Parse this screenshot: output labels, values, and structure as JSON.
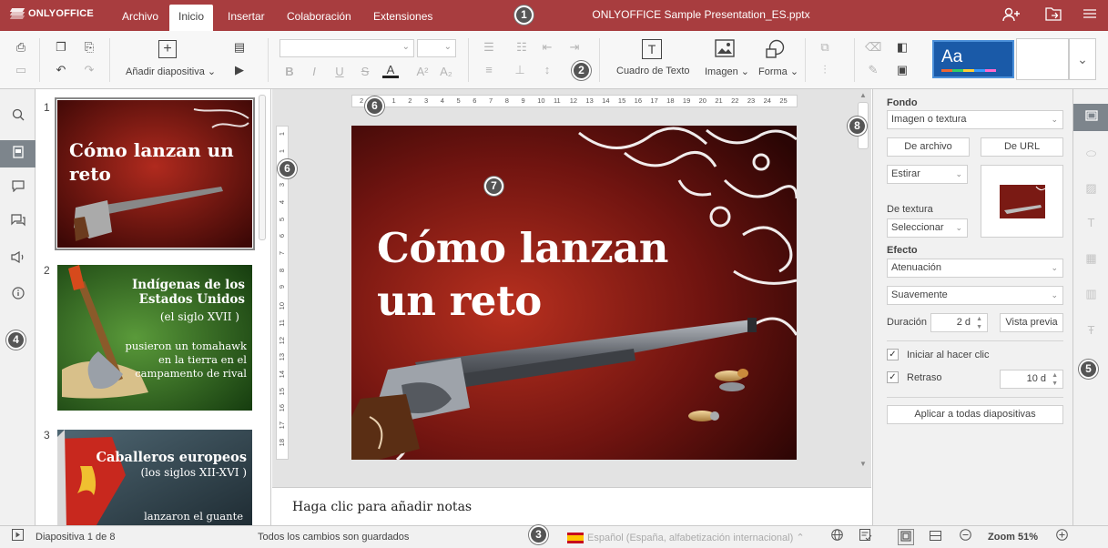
{
  "titlebar": {
    "logo": "ONLYOFFICE",
    "tabs": [
      "Archivo",
      "Inicio",
      "Insertar",
      "Colaboración",
      "Extensiones"
    ],
    "active_tab": "Inicio",
    "doc_title": "ONLYOFFICE Sample Presentation_ES.pptx"
  },
  "toolbar": {
    "add_slide": "Añadir diapositiva",
    "text_box": "Cuadro de Texto",
    "image": "Imagen",
    "shape": "Forma",
    "theme_sample": "Aa"
  },
  "thumbnails": [
    {
      "num": "1",
      "title": "Cómo lanzan un reto"
    },
    {
      "num": "2",
      "title": "Indígenas de los Estados Unidos",
      "subtitle": "(el siglo XVII )",
      "body": "pusieron un tomahawk en la tierra en el campamento de rival"
    },
    {
      "num": "3",
      "title": "Caballeros europeos",
      "subtitle": "(los siglos XII-XVI )",
      "body": "lanzaron el guante"
    }
  ],
  "slide": {
    "title_line1": "Cómo lanzan",
    "title_line2": "un reto"
  },
  "ruler": {
    "h_ticks": [
      "2",
      "1",
      "1",
      "2",
      "3",
      "4",
      "5",
      "6",
      "7",
      "8",
      "9",
      "10",
      "11",
      "12",
      "13",
      "14",
      "15",
      "16",
      "17",
      "18",
      "19",
      "20",
      "21",
      "22",
      "23",
      "24",
      "25"
    ],
    "v_ticks": [
      "1",
      "1",
      "2",
      "3",
      "4",
      "5",
      "6",
      "7",
      "8",
      "9",
      "10",
      "11",
      "12",
      "13",
      "14",
      "15",
      "16",
      "17",
      "18"
    ]
  },
  "notes_placeholder": "Haga clic para añadir notas",
  "right_panel": {
    "fill_label": "Fondo",
    "fill_value": "Imagen o textura",
    "from_file": "De archivo",
    "from_url": "De URL",
    "stretch_value": "Estirar",
    "texture_label": "De textura",
    "texture_value": "Seleccionar",
    "effect_label": "Efecto",
    "effect_value": "Atenuación",
    "effect_sub_value": "Suavemente",
    "duration_label": "Duración",
    "duration_value": "2 d",
    "preview_btn": "Vista previa",
    "start_on_click": "Iniciar al hacer clic",
    "delay_label": "Retraso",
    "delay_value": "10 d",
    "apply_all": "Aplicar a todas diapositivas"
  },
  "statusbar": {
    "slide_count": "Diapositiva 1 de 8",
    "saved": "Todos los cambios son guardados",
    "language": "Español (España, alfabetización internacional)",
    "zoom": "Zoom 51%"
  },
  "callouts": [
    "1",
    "2",
    "3",
    "4",
    "5",
    "6",
    "6",
    "7",
    "8"
  ],
  "colors": {
    "brand": "#a83d3f",
    "slide_bg": "#7a1a14"
  }
}
